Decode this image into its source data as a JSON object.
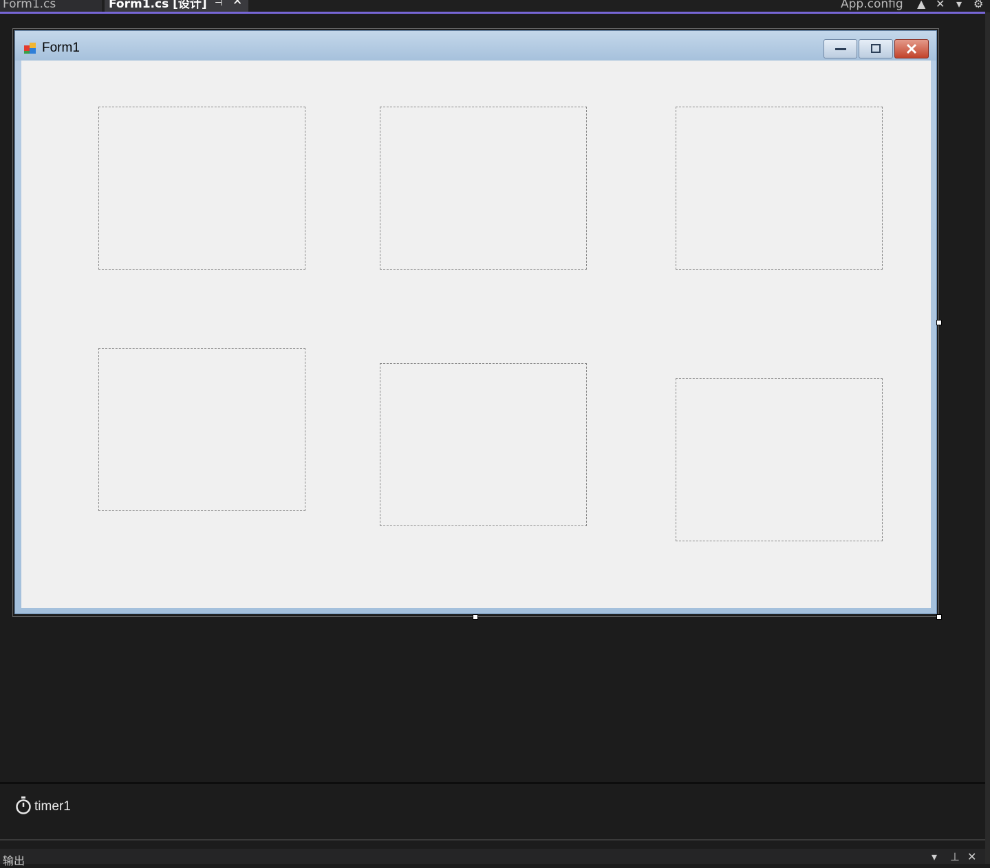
{
  "tabs": [
    {
      "label": "Form1.cs"
    },
    {
      "label": "Form1.cs [设计]"
    },
    {
      "label": "App.config"
    }
  ],
  "form": {
    "title": "Form1",
    "picture_boxes": 6
  },
  "component_tray": {
    "components": [
      {
        "name": "timer1",
        "icon": "stopwatch-icon"
      }
    ]
  },
  "output_pane": {
    "title": "输出"
  },
  "colors": {
    "accent": "#7766d6",
    "close_button": "#c2432b",
    "ide_background": "#1c1c1c",
    "form_client": "#f0f0f0"
  }
}
